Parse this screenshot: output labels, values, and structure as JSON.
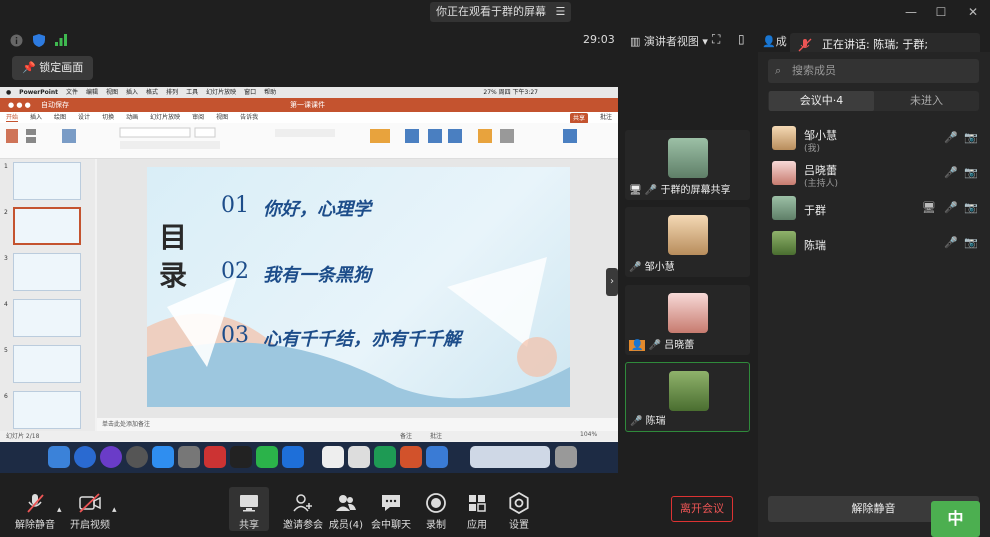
{
  "window": {
    "title": "你正在观看于群的屏幕",
    "minimize": "—",
    "maximize": "☐",
    "close": "✕"
  },
  "share_bar": {
    "timer": "29:03",
    "lock_label": "锁定画面"
  },
  "right_toolbar": {
    "view_label": "演讲者视图",
    "members_short": "成",
    "speaking_label": "正在讲话: 陈瑞; 于群;"
  },
  "shared_screen": {
    "mac_menu": [
      "PowerPoint",
      "文件",
      "编辑",
      "视图",
      "插入",
      "格式",
      "排列",
      "工具",
      "幻灯片放映",
      "窗口",
      "帮助"
    ],
    "mac_status": "27% 周四 下午3:27",
    "ppt_autosave": "自动保存",
    "ppt_doc_title": "第一课课件",
    "ppt_share": "共享",
    "ppt_comment": "批注",
    "ribbon_tabs": [
      "开始",
      "插入",
      "绘图",
      "设计",
      "切换",
      "动画",
      "幻灯片放映",
      "审阅",
      "视图",
      "告诉我"
    ],
    "slide": {
      "heading": "目录",
      "items": [
        {
          "num": "01",
          "text": "你好，心理学"
        },
        {
          "num": "02",
          "text": "我有一条黑狗"
        },
        {
          "num": "03",
          "text": "心有千千结，亦有千千解"
        }
      ]
    },
    "thumb_numbers": [
      "1",
      "2",
      "3",
      "4",
      "5",
      "6"
    ],
    "notes_placeholder": "单击此处添加备注",
    "status_left": "幻灯片 2/18",
    "status_notes": "备注",
    "status_comments": "批注",
    "zoom": "104%"
  },
  "tiles": [
    {
      "name": "于群的屏幕共享"
    },
    {
      "name": "邹小慧"
    },
    {
      "name": "吕晓蕾"
    },
    {
      "name": "陈瑞"
    }
  ],
  "members_panel": {
    "search_placeholder": "搜索成员",
    "tab_in": "会议中·4",
    "tab_out": "未进入",
    "members": [
      {
        "name": "邹小慧",
        "role": "(我)"
      },
      {
        "name": "吕晓蕾",
        "role": "(主持人)"
      },
      {
        "name": "于群",
        "role": ""
      },
      {
        "name": "陈瑞",
        "role": ""
      }
    ],
    "unmute_all": "解除静音"
  },
  "bottom_toolbar": {
    "unmute": "解除静音",
    "start_video": "开启视频",
    "share": "共享",
    "invite": "邀请参会",
    "members": "成员(4)",
    "chat": "会中聊天",
    "record": "录制",
    "apps": "应用",
    "settings": "设置",
    "leave": "离开会议"
  },
  "ime_label": "中",
  "colors": {
    "ppt_orange": "#c4532f",
    "slide_blue": "#1d4d8a",
    "leave_red": "#e55555",
    "active_green": "#2f8a3b"
  }
}
